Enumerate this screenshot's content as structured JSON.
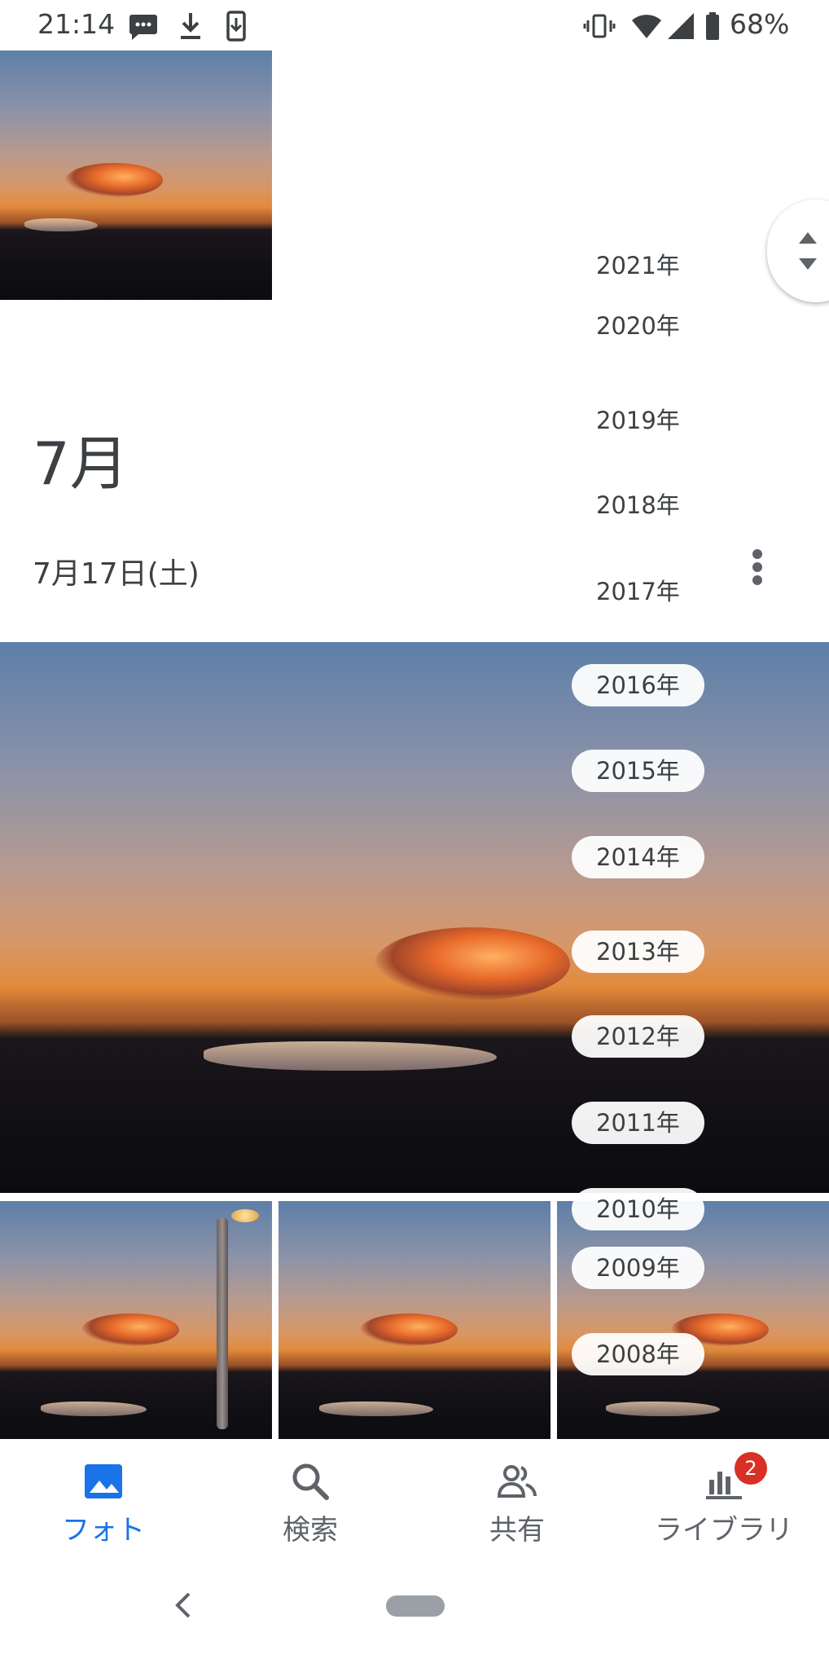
{
  "status_bar": {
    "time": "21:14",
    "battery": "68%",
    "left_icons": [
      "messages-icon",
      "download-icon",
      "phone-download-icon"
    ],
    "right_icons": [
      "vibrate-icon",
      "wifi-icon",
      "signal-icon",
      "battery-icon"
    ]
  },
  "section": {
    "month": "7月",
    "date": "7月17日(土)"
  },
  "year_scroller": {
    "years": [
      "2021年",
      "2020年",
      "2019年",
      "2018年",
      "2017年",
      "2016年",
      "2015年",
      "2014年",
      "2013年",
      "2012年",
      "2011年",
      "2010年",
      "2009年",
      "2008年"
    ]
  },
  "bottom_nav": {
    "items": [
      {
        "label": "フォト",
        "icon": "photo-icon",
        "active": true
      },
      {
        "label": "検索",
        "icon": "search-icon",
        "active": false
      },
      {
        "label": "共有",
        "icon": "people-icon",
        "active": false
      },
      {
        "label": "ライブラリ",
        "icon": "library-icon",
        "active": false,
        "badge": "2"
      }
    ]
  },
  "colors": {
    "accent": "#1a73e8",
    "badge": "#d93025",
    "text": "#3c4043"
  }
}
